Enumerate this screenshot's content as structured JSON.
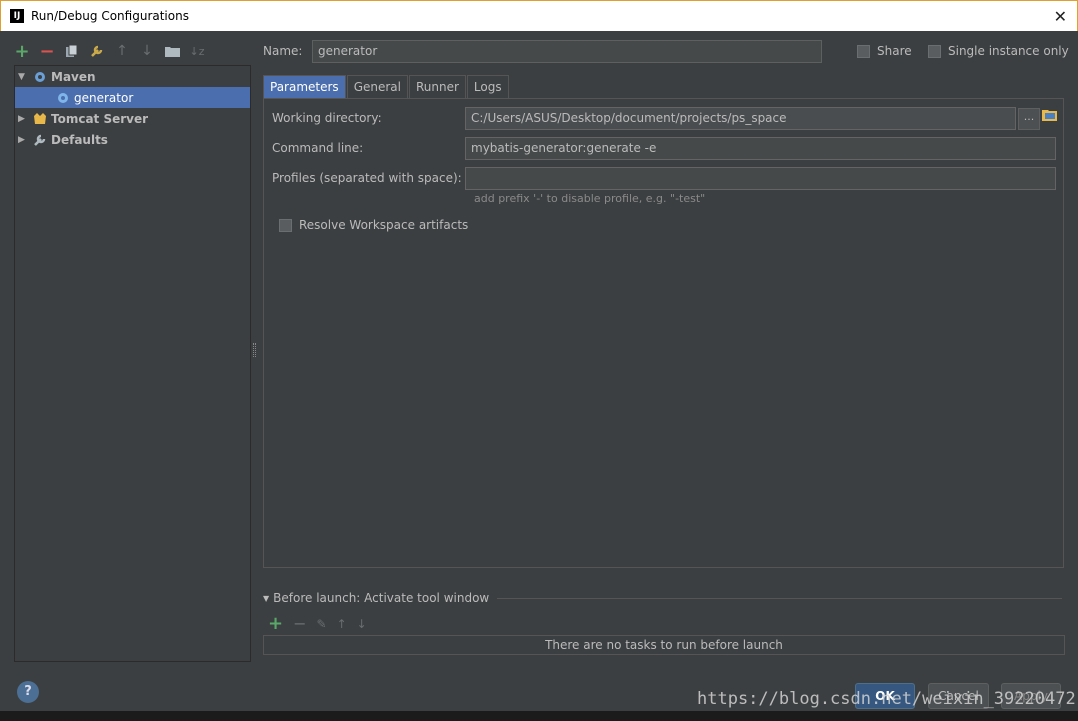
{
  "window": {
    "title": "Run/Debug Configurations",
    "app_icon_text": "IJ"
  },
  "toolbar": {
    "icons": [
      "add-icon",
      "remove-icon",
      "copy-icon",
      "wrench-icon",
      "move-up-icon",
      "move-down-icon",
      "folder-icon",
      "sort-icon"
    ]
  },
  "tree": {
    "items": [
      {
        "label": "Maven",
        "level": 0,
        "expanded": true
      },
      {
        "label": "generator",
        "level": 1,
        "selected": true
      },
      {
        "label": "Tomcat Server",
        "level": 0,
        "expanded": false
      },
      {
        "label": "Defaults",
        "level": 0,
        "expanded": false
      }
    ]
  },
  "form": {
    "name_label": "Name:",
    "name_value": "generator",
    "share_label": "Share",
    "single_instance_label": "Single instance only"
  },
  "tabs": [
    {
      "label": "Parameters",
      "active": true
    },
    {
      "label": "General",
      "active": false
    },
    {
      "label": "Runner",
      "active": false
    },
    {
      "label": "Logs",
      "active": false
    }
  ],
  "parameters": {
    "working_dir_label": "Working directory:",
    "working_dir_value": "C:/Users/ASUS/Desktop/document/projects/ps_space",
    "browse_label": "...",
    "command_line_label": "Command line:",
    "command_line_value": "mybatis-generator:generate -e",
    "profiles_label": "Profiles (separated with space):",
    "profiles_value": "",
    "profiles_hint": "add prefix '-' to disable profile, e.g. \"-test\"",
    "resolve_label": "Resolve Workspace artifacts"
  },
  "before_launch": {
    "title": "Before launch: Activate tool window",
    "empty_text": "There are no tasks to run before launch"
  },
  "buttons": {
    "help": "?",
    "ok": "OK",
    "cancel": "Cancel",
    "apply": "Apply"
  },
  "watermark": "https://blog.csdn.net/weixin_39220472",
  "colors": {
    "accent": "#4b6eaf",
    "background": "#3c3f41",
    "add_green": "#59a869",
    "remove_red": "#d9534f"
  }
}
